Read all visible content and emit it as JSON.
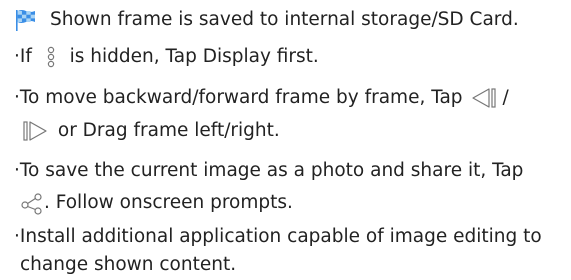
{
  "header": {
    "text": "Shown frame is saved to internal storage/SD Card."
  },
  "bullets": {
    "b1_pre": "If ",
    "b1_post": " is hidden, Tap Display first.",
    "b2_line1": "To move backward/forward frame by frame, Tap ",
    "b2_slash": "/",
    "b2_line2": " or Drag frame left/right.",
    "b3_line1": "To save the current image as a photo and share it, Tap",
    "b3_line2": ". Follow onscreen prompts.",
    "b4_line1": "Install additional application capable of image editing to",
    "b4_line2": "change shown content."
  },
  "bullet_char": "·",
  "icons": {
    "flag": "checkered-flag-icon",
    "menu": "vertical-dots-menu-icon",
    "frame_back": "frame-backward-icon",
    "frame_forward": "frame-forward-icon",
    "share": "share-icon"
  },
  "colors": {
    "flag_blue": "#3a8ee6",
    "flag_light": "#a9d4f5",
    "icon_gray": "#777777",
    "text": "#222222"
  }
}
